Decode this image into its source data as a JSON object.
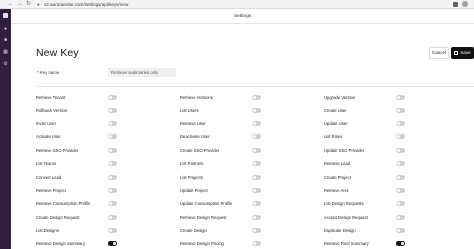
{
  "browser": {
    "url": "v2.auroraeolar.com/settings/api/keys/new"
  },
  "header": {
    "title": "Settings"
  },
  "page": {
    "title": "New Key",
    "cancel_label": "Cancel",
    "save_label": "Save"
  },
  "key_name": {
    "label": "* Key name",
    "value": "Retrieve summaries only"
  },
  "permissions": [
    [
      {
        "label": "Retrieve Tenant",
        "on": false
      },
      {
        "label": "Rollback Version",
        "on": false
      },
      {
        "label": "Invite User",
        "on": false
      },
      {
        "label": "Activate User",
        "on": false
      },
      {
        "label": "Retrieve SSO Provider",
        "on": false
      },
      {
        "label": "List Teams",
        "on": false
      },
      {
        "label": "Convert Lead",
        "on": false
      },
      {
        "label": "Retrieve Project",
        "on": false
      },
      {
        "label": "Retrieve Consumption Profile",
        "on": false
      },
      {
        "label": "Create Design Request",
        "on": false
      },
      {
        "label": "List Designs",
        "on": false
      },
      {
        "label": "Retrieve Design Summary",
        "on": true
      }
    ],
    [
      {
        "label": "Retrieve Versions",
        "on": false
      },
      {
        "label": "List Users",
        "on": false
      },
      {
        "label": "Retrieve User",
        "on": false
      },
      {
        "label": "Deactivate User",
        "on": false
      },
      {
        "label": "Create SSO Provider",
        "on": false
      },
      {
        "label": "List Partners",
        "on": false
      },
      {
        "label": "List Projects",
        "on": false
      },
      {
        "label": "Update Project",
        "on": false
      },
      {
        "label": "Update Consumption Profile",
        "on": false
      },
      {
        "label": "Retrieve Design Request",
        "on": false
      },
      {
        "label": "Create Design",
        "on": false
      },
      {
        "label": "Retrieve Design Pricing",
        "on": false
      }
    ],
    [
      {
        "label": "Upgrade Version",
        "on": false
      },
      {
        "label": "Create User",
        "on": false
      },
      {
        "label": "Update User",
        "on": false
      },
      {
        "label": "List Roles",
        "on": false
      },
      {
        "label": "Update SSO Provider",
        "on": false
      },
      {
        "label": "Retrieve Lead",
        "on": false
      },
      {
        "label": "Create Project",
        "on": false
      },
      {
        "label": "Retrieve AHJ",
        "on": false
      },
      {
        "label": "List Design Requests",
        "on": false
      },
      {
        "label": "Accept Design Request",
        "on": false
      },
      {
        "label": "Duplicate Design",
        "on": false
      },
      {
        "label": "Retrieve Roof Summary",
        "on": true
      }
    ]
  ]
}
